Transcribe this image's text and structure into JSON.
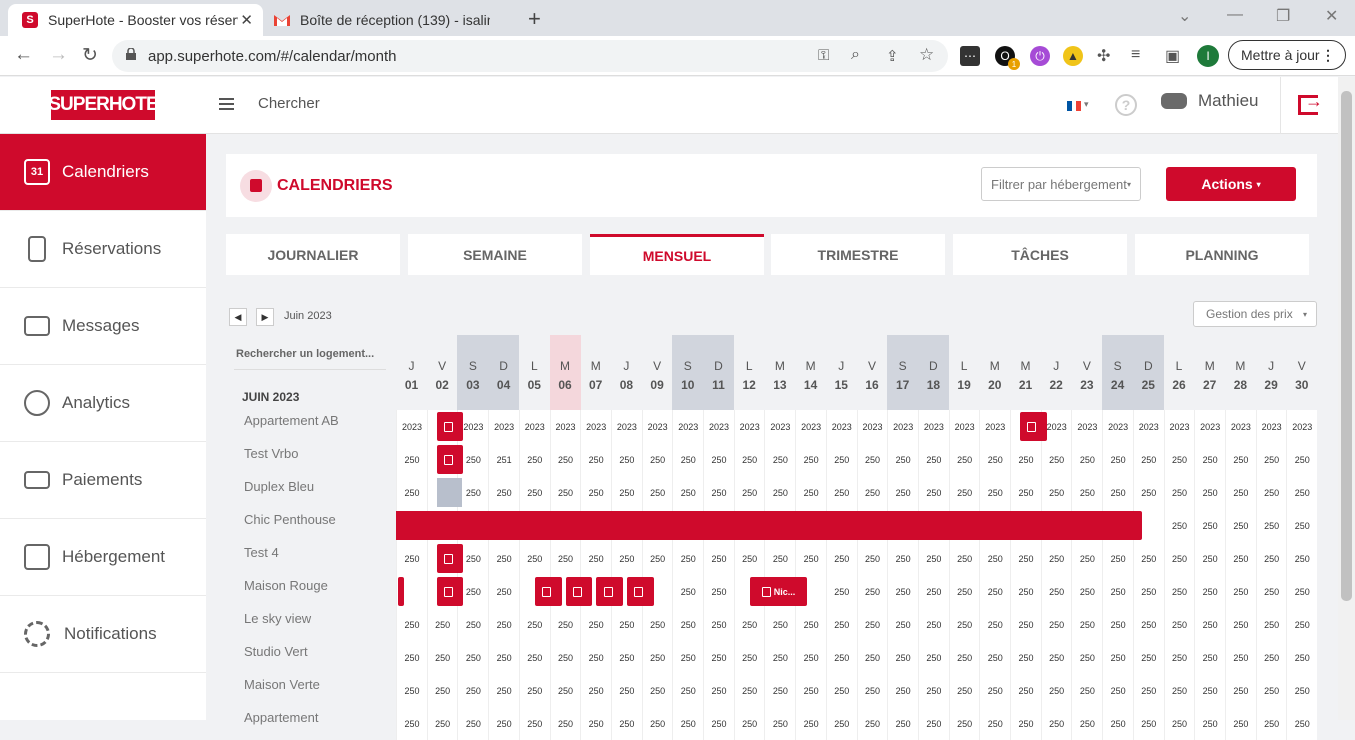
{
  "browser": {
    "tabs": [
      {
        "title": "SuperHote - Booster vos réservat",
        "icon_letter": "S"
      },
      {
        "title": "Boîte de réception (139) - isaline"
      }
    ],
    "url": "app.superhote.com/#/calendar/month",
    "update_label": "Mettre à jour",
    "profile_letter": "I",
    "ext_badge": "1"
  },
  "topbar": {
    "logo": "SUPERHOTE",
    "search": "Chercher",
    "user": "Mathieu"
  },
  "sidebar": [
    {
      "label": "Calendriers",
      "icon": "calendar-icon",
      "day": "31"
    },
    {
      "label": "Réservations",
      "icon": "reservations-icon"
    },
    {
      "label": "Messages",
      "icon": "mail-icon"
    },
    {
      "label": "Analytics",
      "icon": "analytics-icon"
    },
    {
      "label": "Paiements",
      "icon": "card-icon"
    },
    {
      "label": "Hébergement",
      "icon": "house-icon"
    },
    {
      "label": "Notifications",
      "icon": "gear-icon"
    }
  ],
  "header": {
    "title": "CALENDRIERS",
    "filter": "Filtrer par hébergement",
    "actions": "Actions"
  },
  "views": [
    "JOURNALIER",
    "SEMAINE",
    "MENSUEL",
    "TRIMESTRE",
    "TÂCHES",
    "PLANNING"
  ],
  "calendar": {
    "month_label": "Juin 2023",
    "month_header": "JUIN 2023",
    "gestion": "Gestion des prix",
    "search_placeholder": "Rechercher un logement...",
    "days": [
      {
        "l": "J",
        "n": "01"
      },
      {
        "l": "V",
        "n": "02"
      },
      {
        "l": "S",
        "n": "03",
        "we": true
      },
      {
        "l": "D",
        "n": "04",
        "we": true
      },
      {
        "l": "L",
        "n": "05"
      },
      {
        "l": "M",
        "n": "06",
        "today": true
      },
      {
        "l": "M",
        "n": "07"
      },
      {
        "l": "J",
        "n": "08"
      },
      {
        "l": "V",
        "n": "09"
      },
      {
        "l": "S",
        "n": "10",
        "we": true
      },
      {
        "l": "D",
        "n": "11",
        "we": true
      },
      {
        "l": "L",
        "n": "12"
      },
      {
        "l": "M",
        "n": "13"
      },
      {
        "l": "M",
        "n": "14"
      },
      {
        "l": "J",
        "n": "15"
      },
      {
        "l": "V",
        "n": "16"
      },
      {
        "l": "S",
        "n": "17",
        "we": true
      },
      {
        "l": "D",
        "n": "18",
        "we": true
      },
      {
        "l": "L",
        "n": "19"
      },
      {
        "l": "M",
        "n": "20"
      },
      {
        "l": "M",
        "n": "21"
      },
      {
        "l": "J",
        "n": "22"
      },
      {
        "l": "V",
        "n": "23"
      },
      {
        "l": "S",
        "n": "24",
        "we": true
      },
      {
        "l": "D",
        "n": "25",
        "we": true
      },
      {
        "l": "L",
        "n": "26"
      },
      {
        "l": "M",
        "n": "27"
      },
      {
        "l": "M",
        "n": "28"
      },
      {
        "l": "J",
        "n": "29"
      },
      {
        "l": "V",
        "n": "30"
      }
    ],
    "listings": [
      {
        "name": "Appartement AB",
        "price": "2023",
        "bookings": [
          {
            "s": 1,
            "e": 2
          },
          {
            "s": 20,
            "e": 21
          }
        ],
        "blocked": [],
        "overrides": {}
      },
      {
        "name": "Test Vrbo",
        "price": "250",
        "bookings": [
          {
            "s": 1,
            "e": 2
          }
        ],
        "blocked": [],
        "overrides": {
          "3": "251"
        }
      },
      {
        "name": "Duplex Bleu",
        "price": "250",
        "bookings": [],
        "blocked": [
          {
            "s": 1,
            "e": 2
          }
        ],
        "overrides": {}
      },
      {
        "name": "Chic Penthouse",
        "price": "250",
        "bookings": [
          {
            "s": 0,
            "e": 24.3,
            "cont": true,
            "plain": true
          }
        ],
        "blocked": [],
        "overrides": {}
      },
      {
        "name": "Test 4",
        "price": "250",
        "bookings": [
          {
            "s": 1,
            "e": 2
          }
        ],
        "blocked": [],
        "overrides": {}
      },
      {
        "name": "Maison Rouge",
        "price": "250",
        "bookings": [
          {
            "s": -0.25,
            "e": 0.25,
            "plain": true
          },
          {
            "s": 1,
            "e": 2
          },
          {
            "s": 4.2,
            "e": 5.2
          },
          {
            "s": 5.2,
            "e": 6.2
          },
          {
            "s": 6.2,
            "e": 7.2
          },
          {
            "s": 7.2,
            "e": 8.2
          },
          {
            "s": 11.2,
            "e": 13.2,
            "label": "Nic..."
          }
        ],
        "blocked": [],
        "overrides": {}
      },
      {
        "name": "Le sky view",
        "price": "250",
        "bookings": [],
        "blocked": [],
        "overrides": {}
      },
      {
        "name": "Studio Vert",
        "price": "250",
        "bookings": [],
        "blocked": [],
        "overrides": {}
      },
      {
        "name": "Maison Verte",
        "price": "250",
        "bookings": [],
        "blocked": [],
        "overrides": {}
      },
      {
        "name": "Appartement",
        "price": "250",
        "bookings": [],
        "blocked": [],
        "overrides": {}
      }
    ]
  },
  "colors": {
    "brand": "#cf0a2c",
    "weekend": "#d1d5dd",
    "today": "#f4d7dc"
  }
}
